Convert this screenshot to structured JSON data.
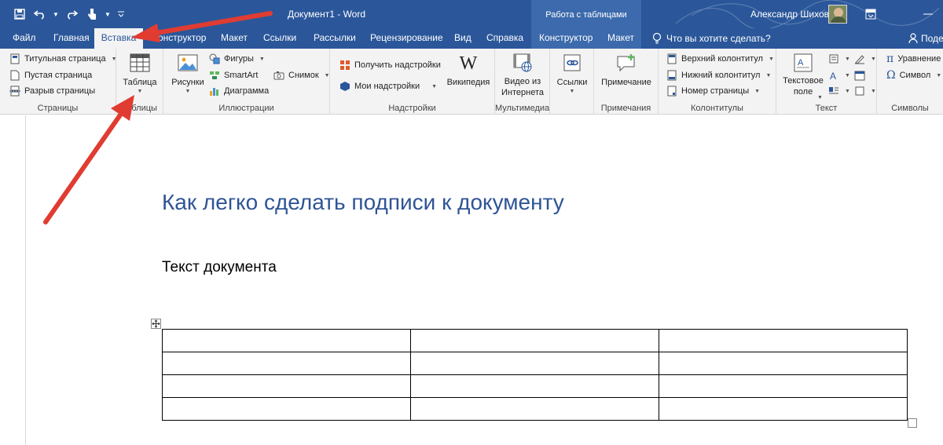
{
  "window": {
    "title": "Документ1 - Word",
    "tool_context": "Работа с таблицами",
    "user": "Александр Шихов"
  },
  "tabs": [
    {
      "label": "Файл"
    },
    {
      "label": "Главная"
    },
    {
      "label": "Вставка",
      "active": true
    },
    {
      "label": "Конструктор"
    },
    {
      "label": "Макет"
    },
    {
      "label": "Ссылки"
    },
    {
      "label": "Рассылки"
    },
    {
      "label": "Рецензирование"
    },
    {
      "label": "Вид"
    },
    {
      "label": "Справка"
    },
    {
      "label": "Конструктор"
    },
    {
      "label": "Макет"
    }
  ],
  "tell_me": "Что вы хотите сделать?",
  "share": "Поде",
  "ribbon": {
    "pages": {
      "label": "Страницы",
      "title_page": "Титульная страница",
      "blank_page": "Пустая страница",
      "page_break": "Разрыв страницы"
    },
    "tables": {
      "label": "Таблицы",
      "table": "Таблица"
    },
    "illustrations": {
      "label": "Иллюстрации",
      "pictures": "Рисунки",
      "shapes": "Фигуры",
      "smartart": "SmartArt",
      "chart": "Диаграмма",
      "screenshot": "Снимок"
    },
    "addins": {
      "label": "Надстройки",
      "get_addins": "Получить надстройки",
      "my_addins": "Мои надстройки",
      "wikipedia": "Википедия"
    },
    "media": {
      "label": "Мультимедиа",
      "online_video_1": "Видео из",
      "online_video_2": "Интернета"
    },
    "links": {
      "label": "Ссылки"
    },
    "comments": {
      "label": "Примечания",
      "comment": "Примечание"
    },
    "header_footer": {
      "label": "Колонтитулы",
      "header": "Верхний колонтитул",
      "footer": "Нижний колонтитул",
      "page_number": "Номер страницы"
    },
    "text": {
      "label": "Текст",
      "textbox_1": "Текстовое",
      "textbox_2": "поле"
    },
    "symbols": {
      "label": "Символы",
      "equation": "Уравнение",
      "symbol": "Символ"
    }
  },
  "document": {
    "heading": "Как легко сделать подписи к документу",
    "text": "Текст документа",
    "table": {
      "rows": 4,
      "cols": 3
    }
  },
  "colors": {
    "accent": "#2b579a",
    "heading": "#2f5496",
    "arrow": "#e03c31"
  }
}
